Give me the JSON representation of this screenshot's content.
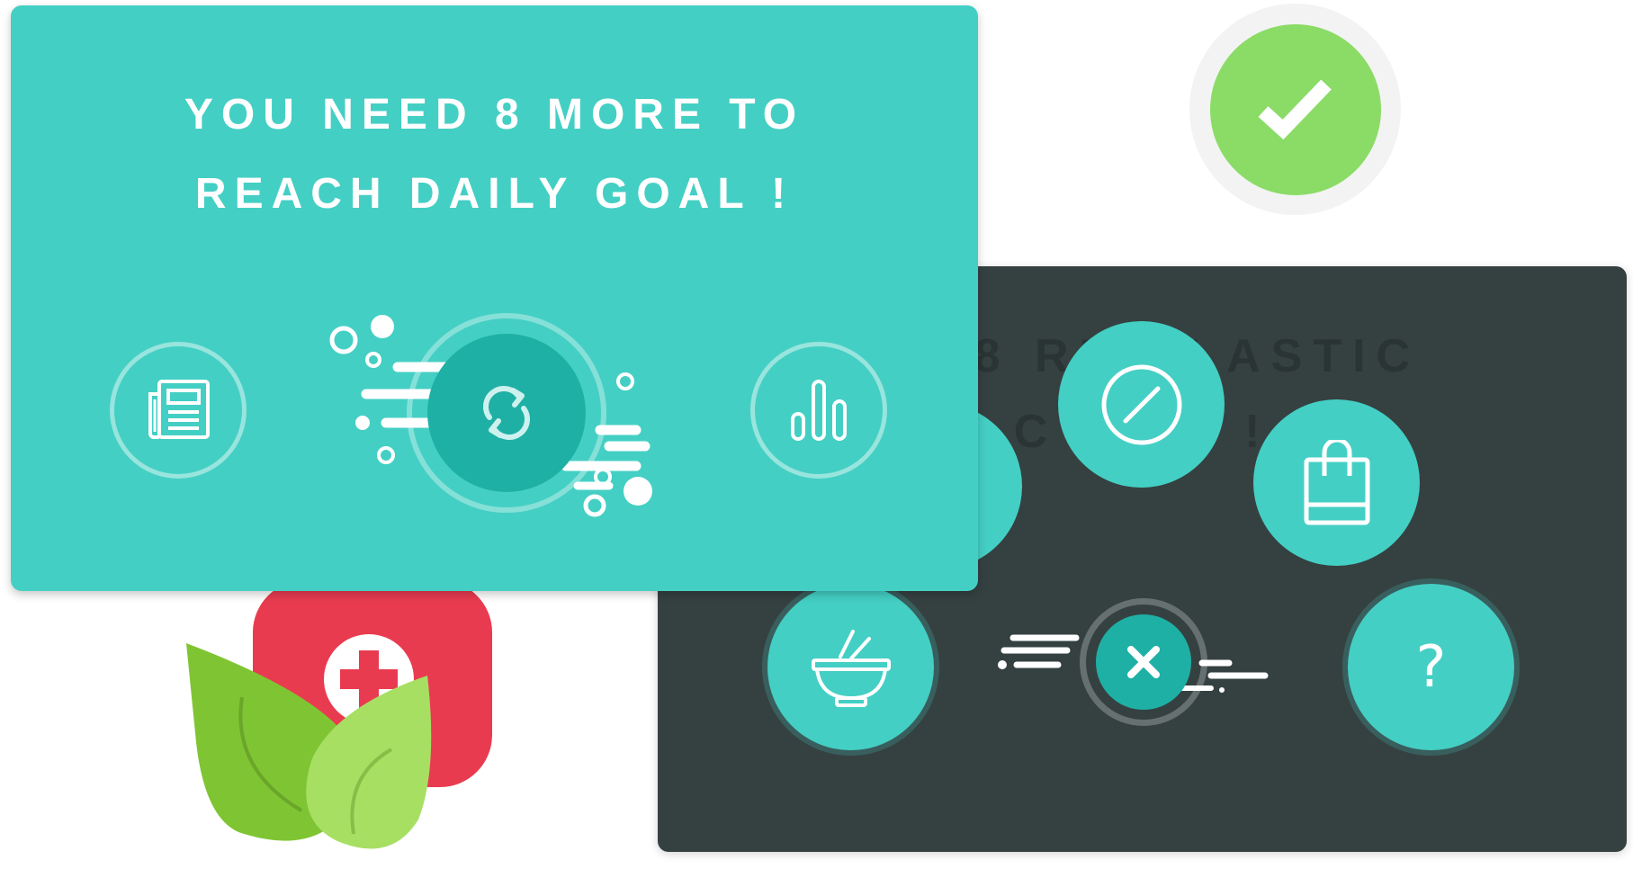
{
  "goal_card": {
    "line1": "YOU NEED 8 MORE TO",
    "line2": "REACH DAILY GOAL !",
    "left_button_icon": "newspaper-icon",
    "center_button_icon": "refresh-icon",
    "right_button_icon": "bar-chart-icon"
  },
  "plastic_card": {
    "line1_visible": "ED 8     RE PLASTIC",
    "line2_visible": "C      LY      L !",
    "bubble_icons": [
      "forbidden-icon",
      "shopping-bag-icon",
      "bowl-chopsticks-icon",
      "close-icon",
      "question-icon"
    ],
    "question_label": "?"
  },
  "check_badge": {
    "icon": "checkmark-icon"
  },
  "illustration": {
    "icons": [
      "first-aid-kit-icon",
      "leaves-icon"
    ]
  },
  "colors": {
    "teal": "#44cfc4",
    "teal_dark": "#1fb0a5",
    "dark_card": "#354141",
    "green_badge": "#8bdc66",
    "kit_red": "#e93b50",
    "leaf_dark": "#7fc533",
    "leaf_light": "#a7df63"
  }
}
